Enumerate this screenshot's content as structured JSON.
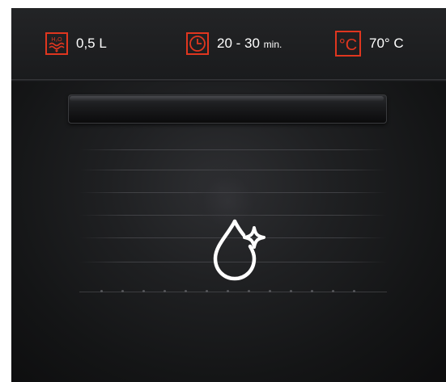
{
  "specs": {
    "water": {
      "icon": "water-h2o-icon",
      "icon_text": "H₂O",
      "value": "0,5 L"
    },
    "time": {
      "icon": "clock-icon",
      "value": "20 - 30",
      "unit": "min."
    },
    "temperature": {
      "icon": "celsius-icon",
      "icon_text": "°C",
      "value": "70° C"
    }
  },
  "center_icon": "steam-clean-drop-sparkle-icon",
  "colors": {
    "accent": "#e0361f",
    "text": "#ffffff",
    "oven_body": "#1a1b1d"
  }
}
